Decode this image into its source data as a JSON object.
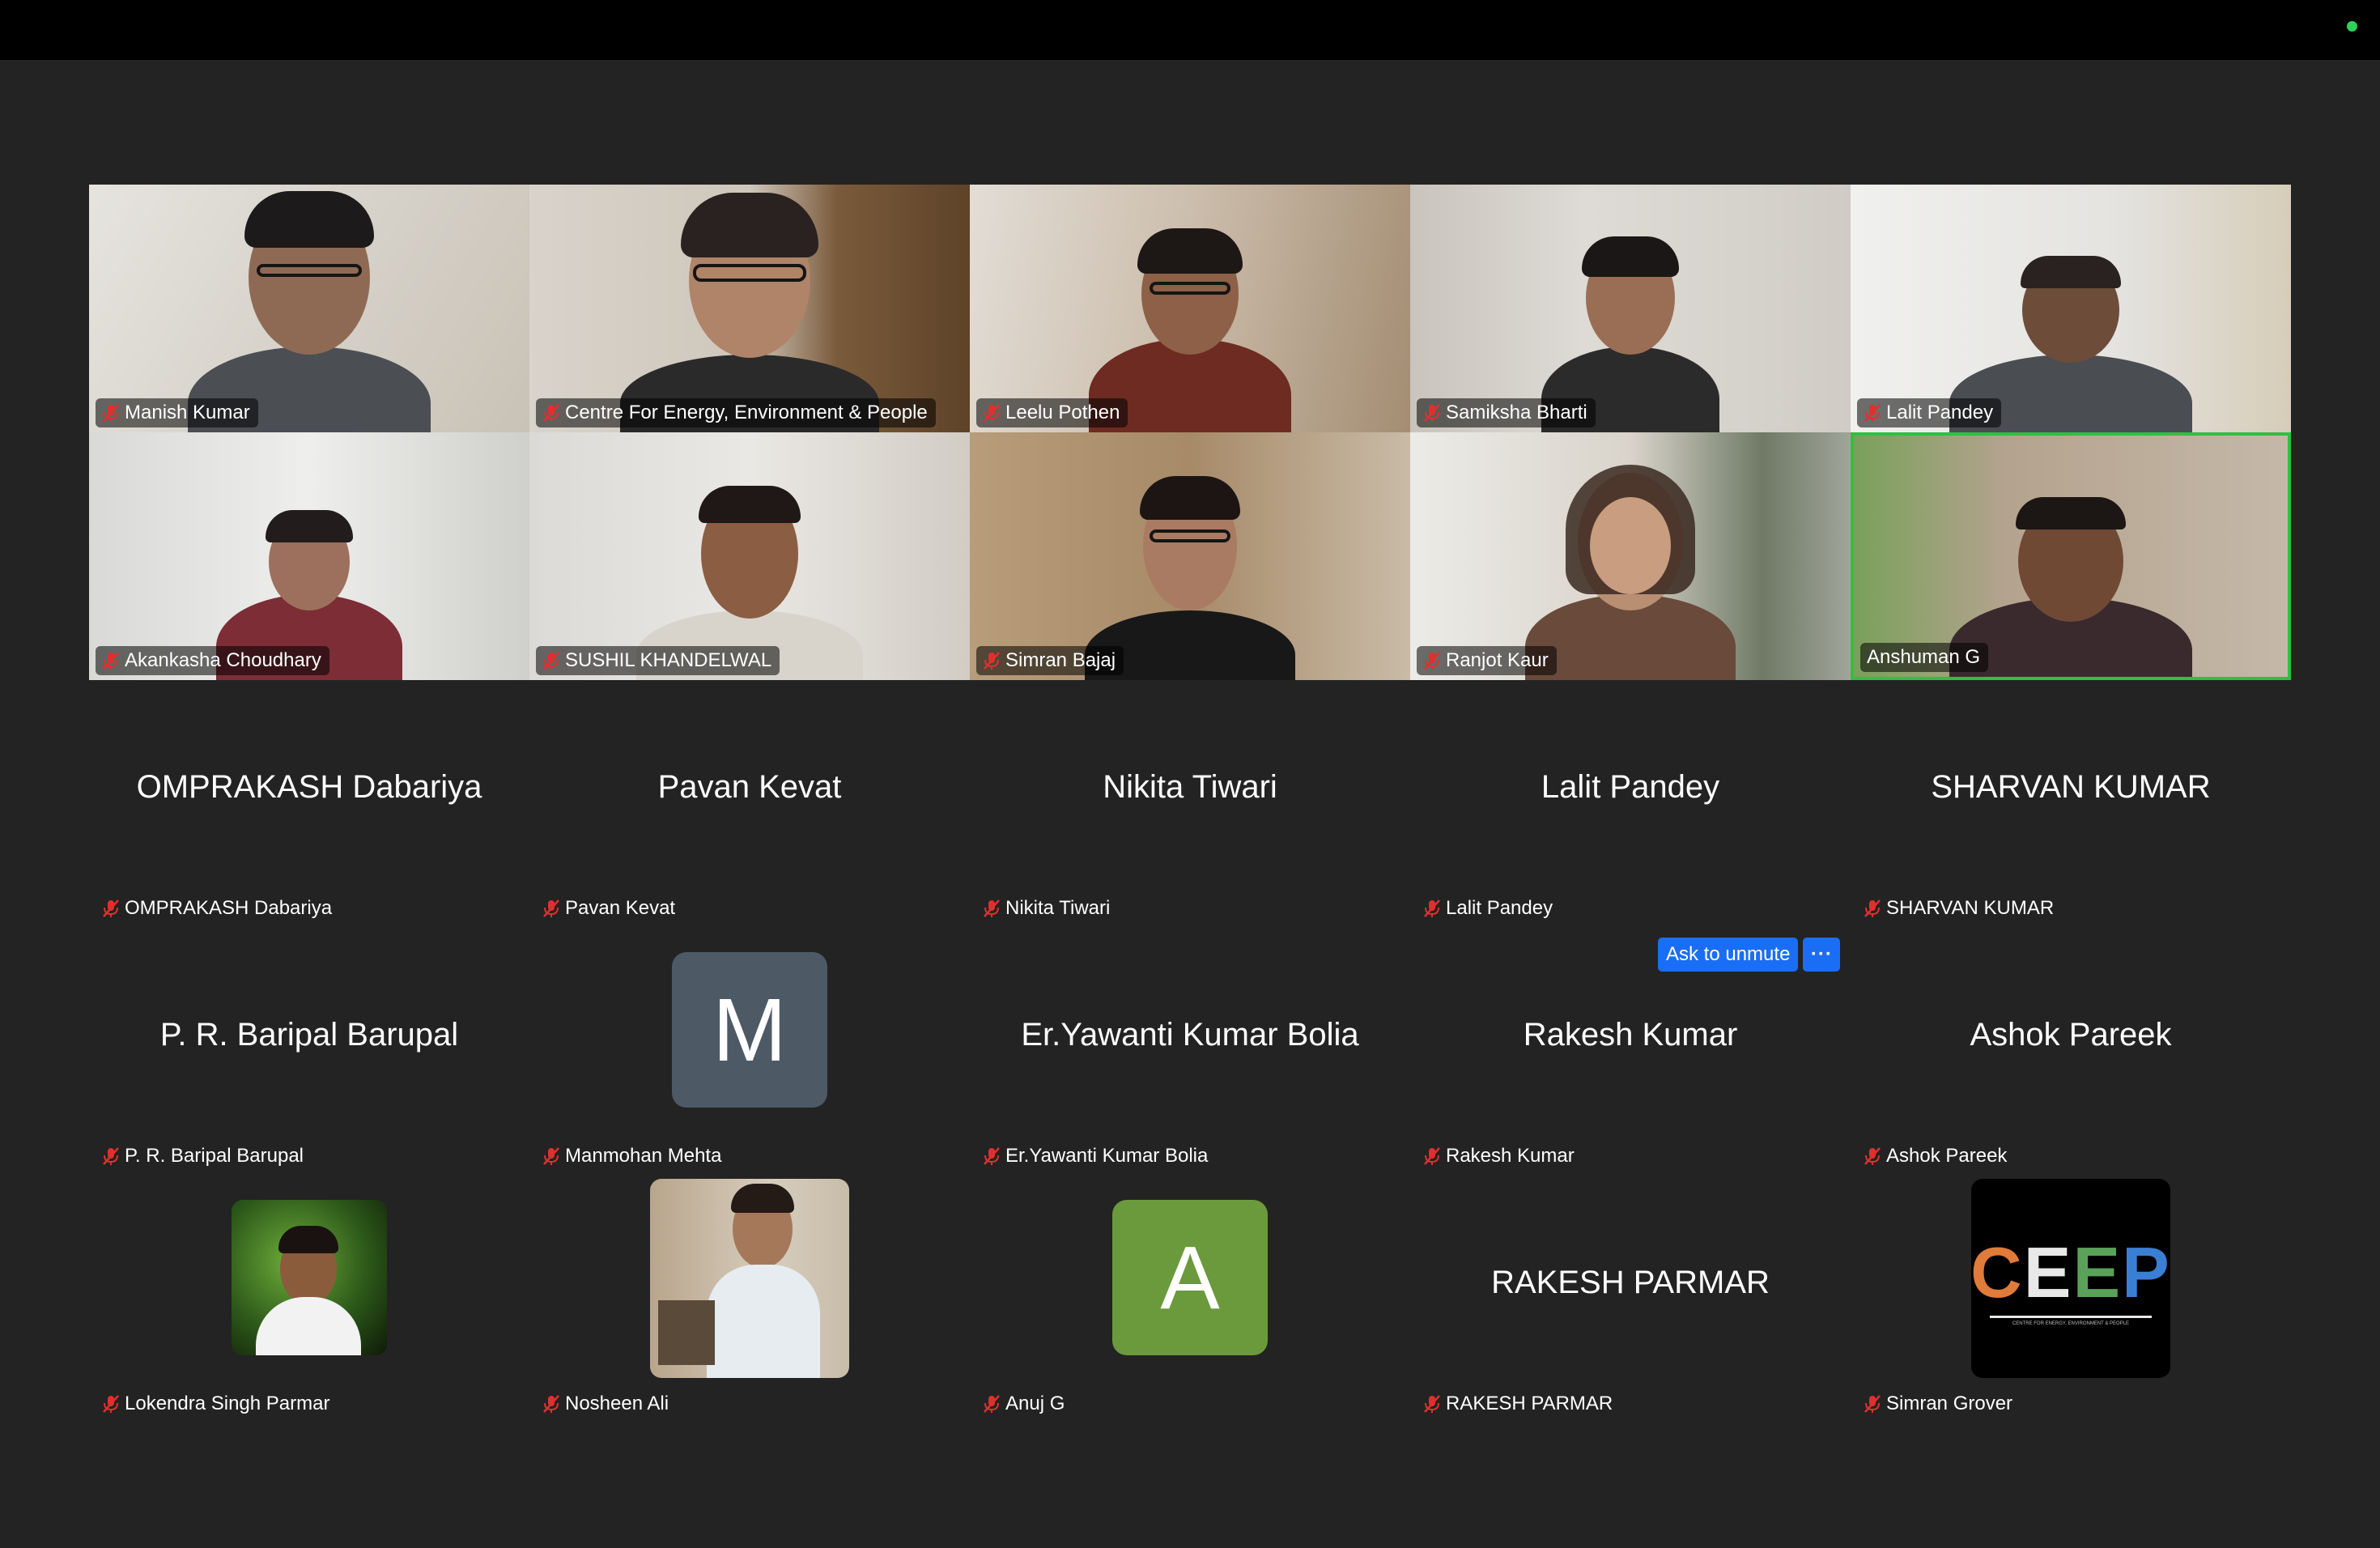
{
  "colors": {
    "active_border": "#2fbf45",
    "status_dot": "#2fd158",
    "button": "#1a6ef5",
    "muted_mic": "#e0302e"
  },
  "participants": {
    "video": [
      {
        "name": "Manish Kumar"
      },
      {
        "name": "Centre For Energy, Environment & People"
      },
      {
        "name": "Leelu Pothen"
      },
      {
        "name": "Samiksha Bharti"
      },
      {
        "name": "Lalit Pandey"
      },
      {
        "name": "Akankasha Choudhary"
      },
      {
        "name": "SUSHIL KHANDELWAL"
      },
      {
        "name": "Simran Bajaj"
      },
      {
        "name": "Ranjot Kaur"
      },
      {
        "name": "Anshuman G"
      }
    ],
    "no_video": [
      {
        "display": "OMPRAKASH Dabariya",
        "name": "OMPRAKASH Dabariya"
      },
      {
        "display": "Pavan Kevat",
        "name": "Pavan Kevat"
      },
      {
        "display": "Nikita Tiwari",
        "name": "Nikita Tiwari"
      },
      {
        "display": "Lalit Pandey",
        "name": "Lalit Pandey"
      },
      {
        "display": "SHARVAN KUMAR",
        "name": "SHARVAN KUMAR"
      },
      {
        "display": "P. R. Baripal Barupal",
        "name": "P. R. Baripal Barupal"
      },
      {
        "letter": "M",
        "name": "Manmohan Mehta"
      },
      {
        "display": "Er.Yawanti Kumar Bolia",
        "name": "Er.Yawanti Kumar Bolia"
      },
      {
        "display": "Rakesh Kumar",
        "name": "Rakesh Kumar"
      },
      {
        "display": "Ashok Pareek",
        "name": "Ashok Pareek"
      },
      {
        "name": "Lokendra Singh Parmar"
      },
      {
        "name": "Nosheen Ali"
      },
      {
        "letter": "A",
        "name": "Anuj G"
      },
      {
        "display": "RAKESH PARMAR",
        "name": "RAKESH PARMAR"
      },
      {
        "name": "Simran Grover",
        "logo_text": "CEEP",
        "logo_subtext": "CENTRE FOR ENERGY, ENVIRONMENT & PEOPLE"
      }
    ]
  },
  "controls": {
    "ask_to_unmute": "Ask to unmute",
    "more": "···"
  }
}
